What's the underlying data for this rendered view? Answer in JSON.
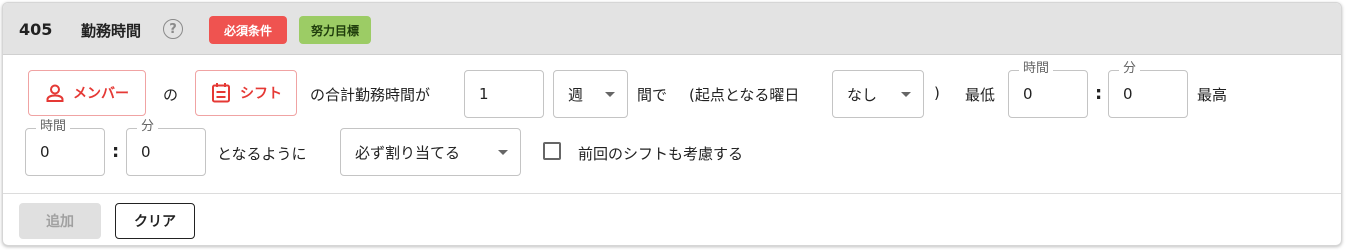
{
  "header": {
    "number": "405",
    "title": "勤務時間",
    "help_icon": "help-circle-icon",
    "badges": [
      {
        "label": "必須条件",
        "color": "#ef5350"
      },
      {
        "label": "努力目標",
        "color": "#9ccc65"
      }
    ]
  },
  "rule": {
    "member_button": {
      "label": "メンバー",
      "icon": "person-icon"
    },
    "text_no": "の",
    "shift_button": {
      "label": "シフト",
      "icon": "calendar-list-icon"
    },
    "text_total": "の合計勤務時間が",
    "period_value": "1",
    "period_unit": "週",
    "text_between": "間で",
    "text_start_open": "(起点となる曜日",
    "start_weekday": "なし",
    "text_start_close": ")",
    "text_min": "最低",
    "min_hours": {
      "legend": "時間",
      "value": "0"
    },
    "min_minutes": {
      "legend": "分",
      "value": "0"
    },
    "text_max": "最高",
    "max_hours": {
      "legend": "時間",
      "value": "0"
    },
    "max_minutes": {
      "legend": "分",
      "value": "0"
    },
    "colon": ":",
    "text_so_that": "となるように",
    "assign_mode": "必ず割り当てる",
    "consider_previous_label": "前回のシフトも考慮する",
    "consider_previous_checked": false
  },
  "footer": {
    "add_label": "追加",
    "clear_label": "クリア"
  },
  "colors": {
    "accent_red": "#e53935",
    "header_bg": "#e3e3e3"
  }
}
